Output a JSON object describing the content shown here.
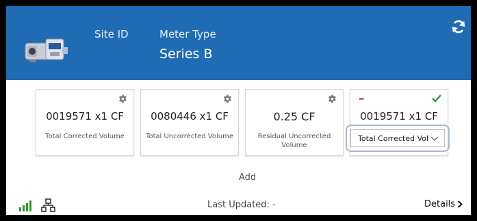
{
  "header": {
    "site_label": "Site ID",
    "meter_type_label": "Meter Type",
    "meter_type_value": "Series B",
    "refresh_icon": "refresh-icon",
    "device_image": "meter-device-image"
  },
  "cards": [
    {
      "value": "0019571 x1 CF",
      "label": "Total Corrected Volume"
    },
    {
      "value": "0080446 x1 CF",
      "label": "Total Uncorrected Volume"
    },
    {
      "value": "0.25 CF",
      "label": "Residual Uncorrected Volume"
    },
    {
      "value": "0019571 x1 CF",
      "selected_option": "Total Corrected Volume",
      "status_icon": "checkmark-icon",
      "remove_icon": "minus-icon"
    }
  ],
  "add_label": "Add",
  "footer": {
    "last_updated": "Last Updated: -",
    "details_label": "Details",
    "signal_icon": "signal-bars-icon",
    "network_icon": "network-icon"
  },
  "colors": {
    "header_bg": "#1f6cb5",
    "check_green": "#2e9e3a",
    "minus_red": "#c62828",
    "signal_green": "#2b9a2b"
  }
}
